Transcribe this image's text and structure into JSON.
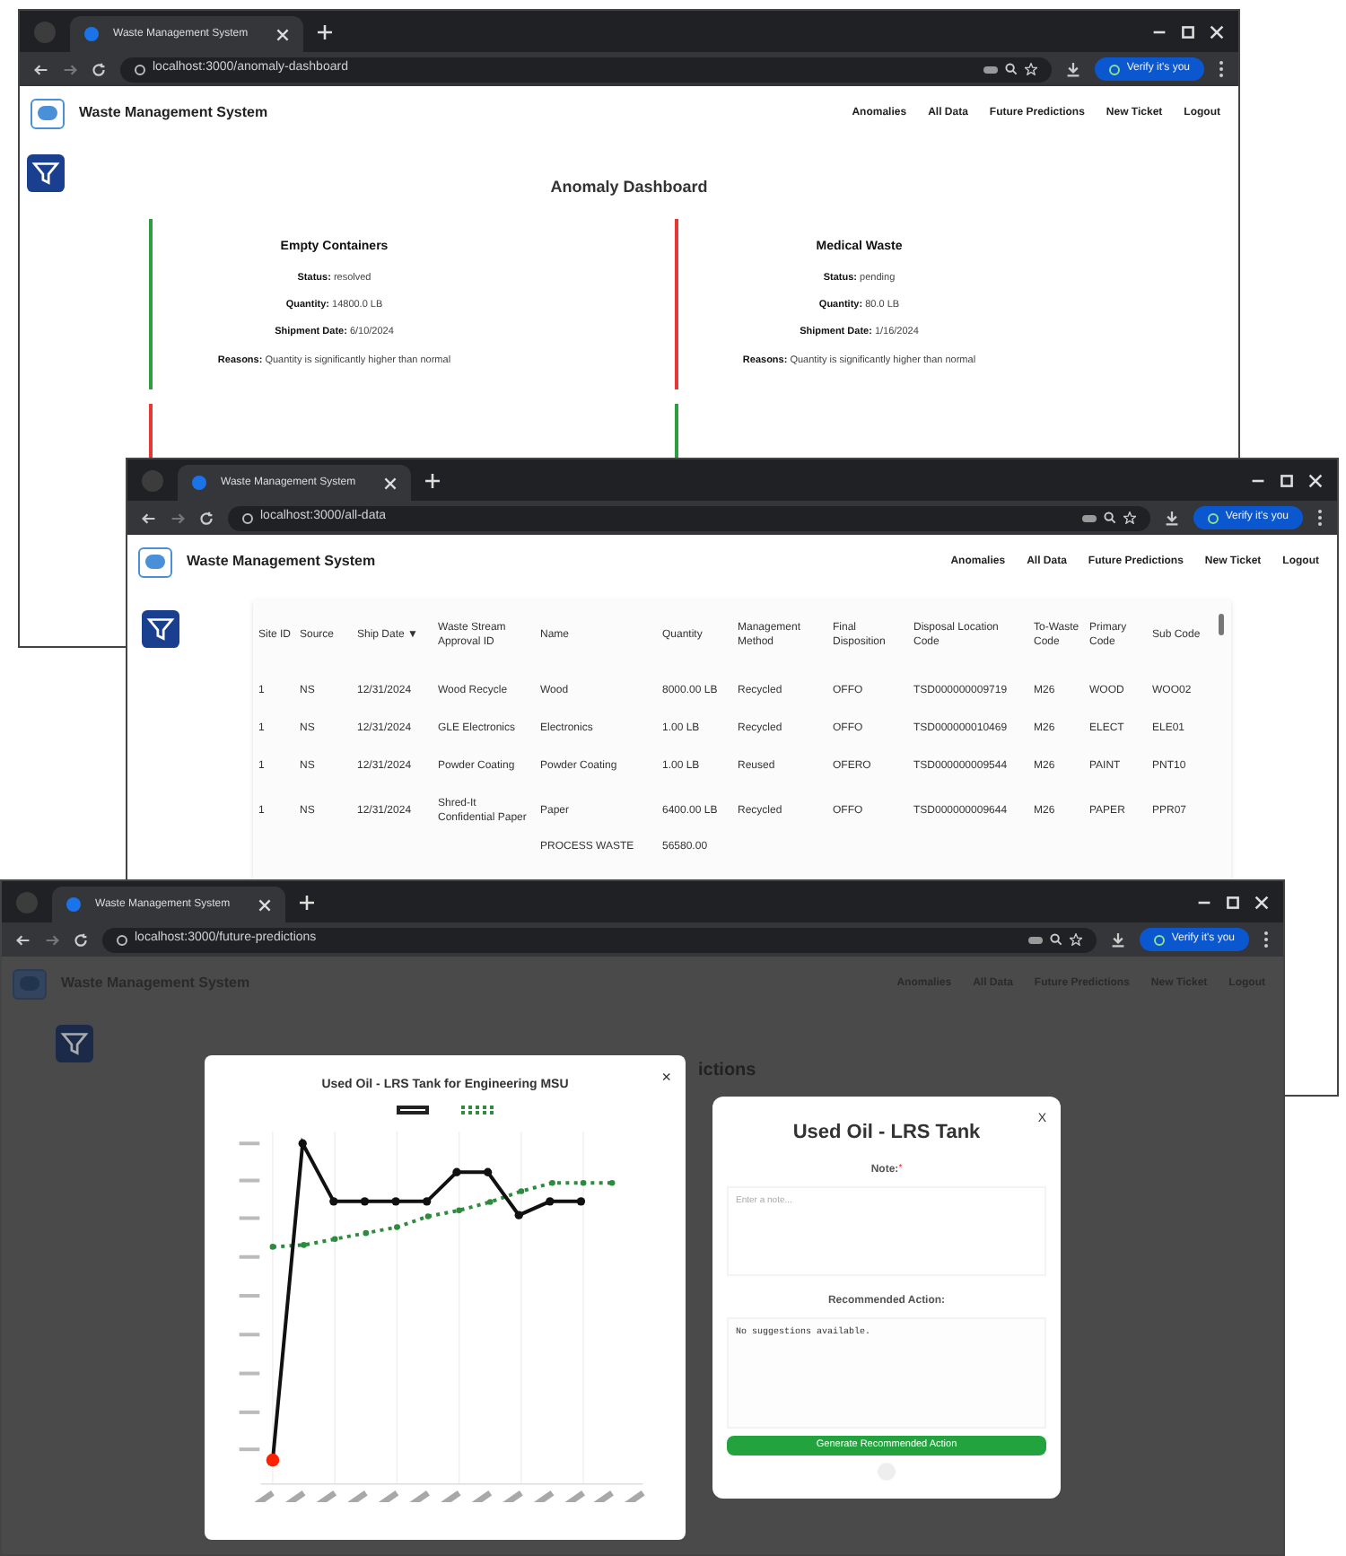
{
  "windows": [
    {
      "kind": "anomalies",
      "tab_title": "Waste Management System",
      "url": "localhost:3000/anomaly-dashboard",
      "verify_label": "Verify it's you",
      "app_title": "Waste Management System",
      "nav": [
        "Anomalies",
        "All Data",
        "Future Predictions",
        "New Ticket",
        "Logout"
      ],
      "heading": "Anomaly Dashboard",
      "cards": [
        {
          "title": "Empty Containers",
          "color": "#2e9e3e",
          "fields": [
            {
              "label": "Status:",
              "value": "resolved"
            },
            {
              "label": "Quantity:",
              "value": "14800.0 LB"
            },
            {
              "label": "Shipment Date:",
              "value": "6/10/2024"
            },
            {
              "label": "Reasons:",
              "value": "Quantity is significantly higher than normal"
            }
          ]
        },
        {
          "title": "Medical Waste",
          "color": "#e53935",
          "fields": [
            {
              "label": "Status:",
              "value": "pending"
            },
            {
              "label": "Quantity:",
              "value": "80.0 LB"
            },
            {
              "label": "Shipment Date:",
              "value": "1/16/2024"
            },
            {
              "label": "Reasons:",
              "value": "Quantity is significantly higher than normal"
            }
          ]
        }
      ],
      "more_cards": [
        {
          "color": "#e53935"
        },
        {
          "color": "#2e9e3e"
        }
      ]
    },
    {
      "kind": "table",
      "tab_title": "Waste Management System",
      "url": "localhost:3000/all-data",
      "verify_label": "Verify it's you",
      "app_title": "Waste Management System",
      "nav": [
        "Anomalies",
        "All Data",
        "Future Predictions",
        "New Ticket",
        "Logout"
      ],
      "columns": [
        "Site ID",
        "Source",
        "Ship Date ▼",
        "Waste Stream Approval ID",
        "Name",
        "Quantity",
        "Management Method",
        "Final Disposition",
        "Disposal Location Code",
        "To-Waste Code",
        "Primary Code",
        "Sub Code"
      ],
      "rows": [
        [
          "1",
          "NS",
          "12/31/2024",
          "Wood Recycle",
          "Wood",
          "8000.00 LB",
          "Recycled",
          "OFFO",
          "TSD000000009719",
          "M26",
          "WOOD",
          "WOO02"
        ],
        [
          "1",
          "NS",
          "12/31/2024",
          "GLE Electronics",
          "Electronics",
          "1.00 LB",
          "Recycled",
          "OFFO",
          "TSD000000010469",
          "M26",
          "ELECT",
          "ELE01"
        ],
        [
          "1",
          "NS",
          "12/31/2024",
          "Powder Coating",
          "Powder Coating",
          "1.00 LB",
          "Reused",
          "OFERO",
          "TSD000000009544",
          "M26",
          "PAINT",
          "PNT10"
        ],
        [
          "1",
          "NS",
          "12/31/2024",
          "Shred-It Confidential Paper",
          "Paper",
          "6400.00 LB",
          "Recycled",
          "OFFO",
          "TSD000000009644",
          "M26",
          "PAPER",
          "PPR07"
        ]
      ],
      "partial_row": {
        "name": "PROCESS WASTE",
        "quantity": "56580.00"
      }
    },
    {
      "kind": "predictions",
      "tab_title": "Waste Management System",
      "url": "localhost:3000/future-predictions",
      "verify_label": "Verify it's you",
      "app_title": "Waste Management System",
      "nav": [
        "Anomalies",
        "All Data",
        "Future Predictions",
        "New Ticket",
        "Logout"
      ],
      "heading_fragment": "ictions",
      "chart_modal": {
        "title": "Used Oil - LRS Tank for Engineering MSU",
        "close": "×"
      },
      "action_modal": {
        "title": "Used Oil - LRS Tank",
        "close": "X",
        "note_label": "Note:",
        "required_mark": "*",
        "note_placeholder": "Enter a note...",
        "action_label": "Recommended Action:",
        "action_value": "No suggestions available.",
        "button": "Generate Recommended Action"
      }
    }
  ]
}
